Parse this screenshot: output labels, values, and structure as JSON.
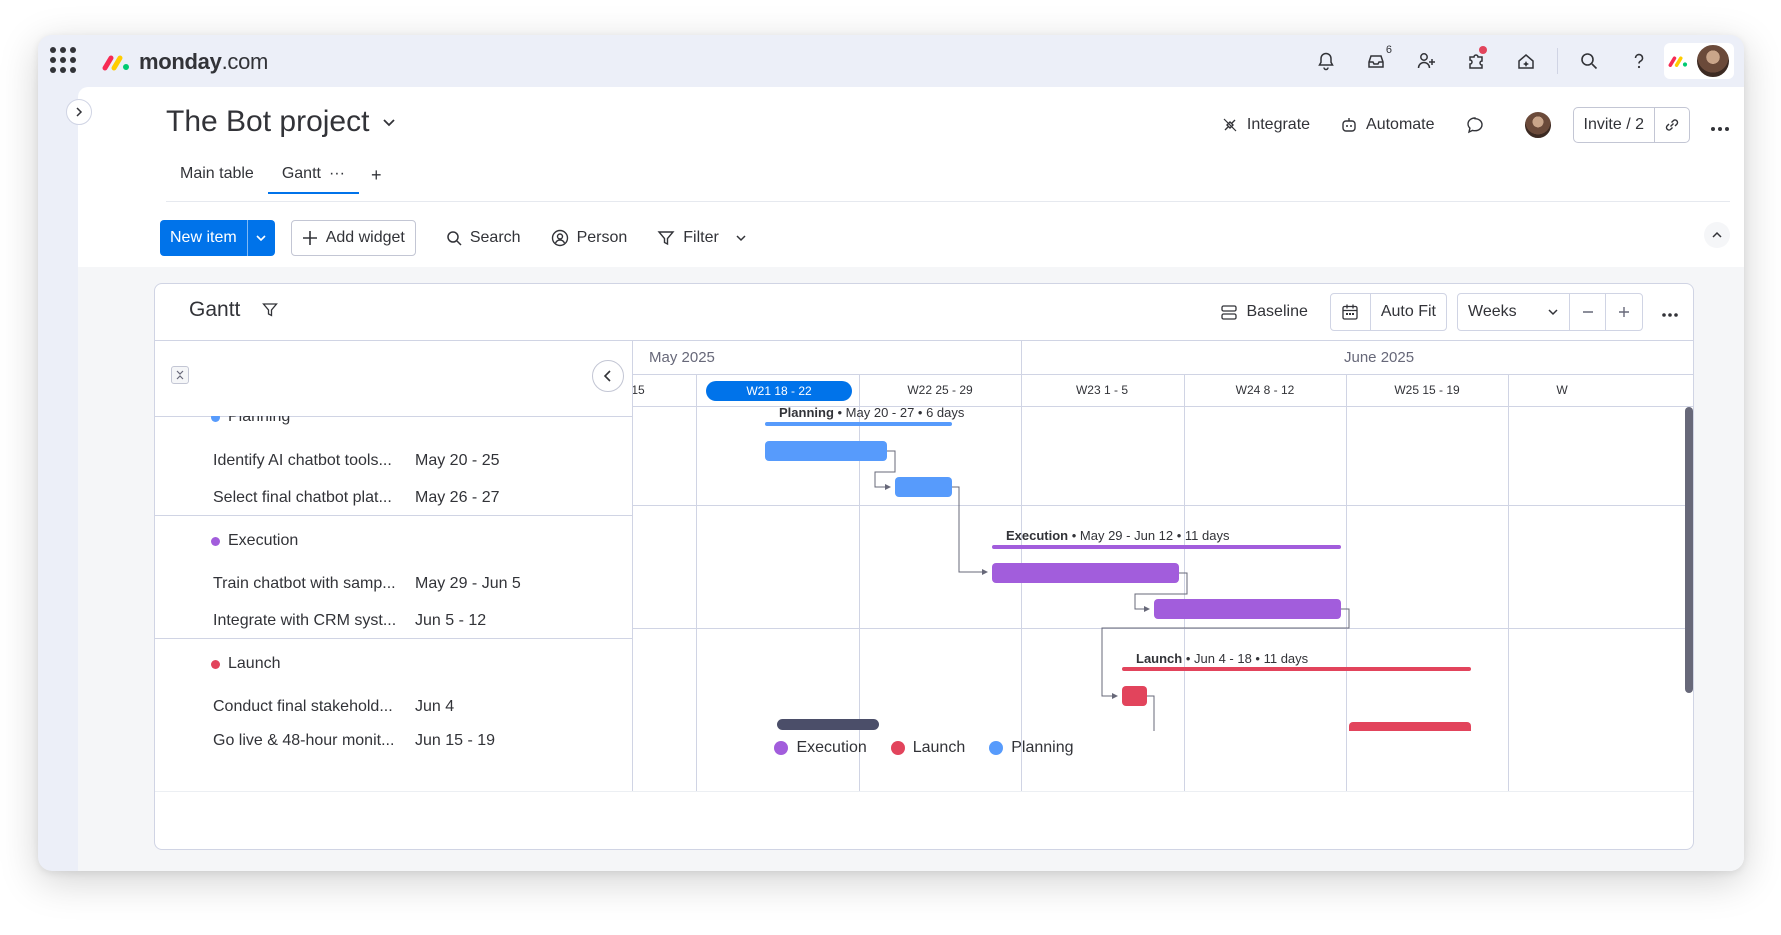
{
  "app": {
    "brand_bold": "monday",
    "brand_light": ".com",
    "inbox_count": "6"
  },
  "board": {
    "title": "The Bot project",
    "integrate": "Integrate",
    "automate": "Automate",
    "invite": "Invite / 2"
  },
  "tabs": [
    {
      "label": "Main table"
    },
    {
      "label": "Gantt"
    }
  ],
  "toolbar": {
    "new_item": "New item",
    "add_widget": "Add widget",
    "search": "Search",
    "person": "Person",
    "filter": "Filter"
  },
  "widget": {
    "title": "Gantt",
    "baseline": "Baseline",
    "auto_fit": "Auto Fit",
    "zoom": "Weeks"
  },
  "timeline": {
    "months": [
      "May 2025",
      "June 2025"
    ],
    "weeks": [
      "15",
      "W21 18 - 22",
      "W22 25 - 29",
      "W23 1 - 5",
      "W24 8 - 12",
      "W25 15 - 19",
      "W"
    ],
    "current_week": "W21 18 - 22"
  },
  "groups": [
    {
      "name": "Planning",
      "color": "#579bfc",
      "summary_name": "Planning",
      "summary_detail": " • May 20 - 27 • 6 days",
      "items": [
        {
          "name": "Identify AI chatbot tools...",
          "dates": "May 20 - 25"
        },
        {
          "name": "Select final chatbot plat...",
          "dates": "May 26 - 27"
        }
      ]
    },
    {
      "name": "Execution",
      "color": "#a25ddc",
      "summary_name": "Execution",
      "summary_detail": " • May 29 - Jun 12 • 11 days",
      "items": [
        {
          "name": "Train chatbot with samp...",
          "dates": "May 29 - Jun 5"
        },
        {
          "name": "Integrate with CRM syst...",
          "dates": "Jun 5 - 12"
        }
      ]
    },
    {
      "name": "Launch",
      "color": "#e2445c",
      "summary_name": "Launch",
      "summary_detail": " • Jun 4 - 18 • 11 days",
      "items": [
        {
          "name": "Conduct final stakehold...",
          "dates": "Jun 4"
        },
        {
          "name": "Go live & 48-hour monit...",
          "dates": "Jun 15 - 19"
        }
      ]
    }
  ],
  "legend": [
    {
      "label": "Execution",
      "color": "#a25ddc"
    },
    {
      "label": "Launch",
      "color": "#e2445c"
    },
    {
      "label": "Planning",
      "color": "#579bfc"
    }
  ],
  "colors": {
    "primary": "#0073ea",
    "baseline_bar": "#4b4e69"
  }
}
